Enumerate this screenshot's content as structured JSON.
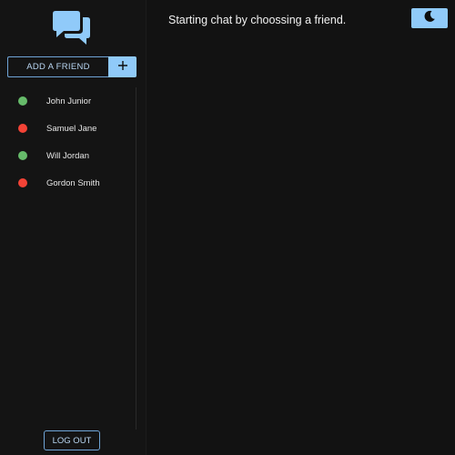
{
  "sidebar": {
    "logo_icon": "chat-bubbles-icon",
    "add_friend": {
      "label": "ADD A FRIEND",
      "icon": "plus-icon"
    },
    "friends": [
      {
        "name": "John Junior",
        "status": "online"
      },
      {
        "name": "Samuel Jane",
        "status": "offline"
      },
      {
        "name": "Will Jordan",
        "status": "online"
      },
      {
        "name": "Gordon Smith",
        "status": "offline"
      }
    ],
    "logout_label": "LOG OUT"
  },
  "main": {
    "prompt": "Starting chat by choossing a friend.",
    "theme_toggle_icon": "moon-icon"
  },
  "colors": {
    "background": "#121212",
    "accent": "#90caf9",
    "online": "#66bb6a",
    "offline": "#f44336"
  }
}
